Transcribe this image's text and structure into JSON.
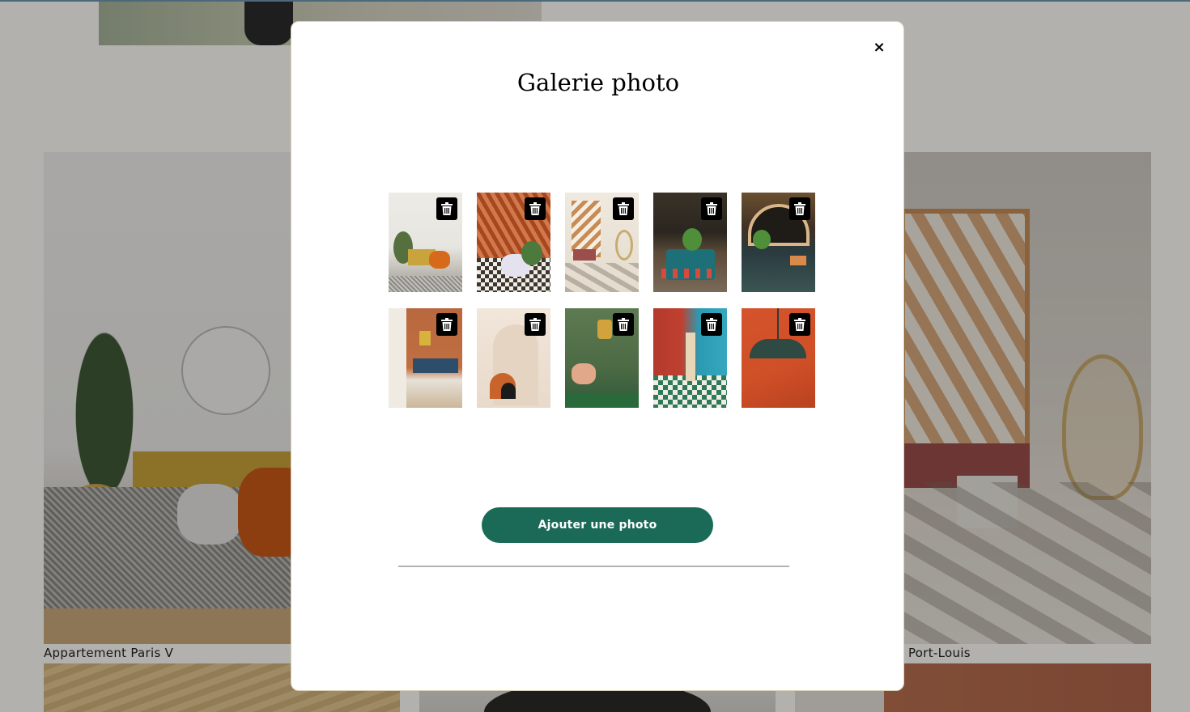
{
  "background": {
    "card_captions": {
      "left": "Appartement Paris V",
      "right": "Port-Louis"
    }
  },
  "modal": {
    "close_label": "×",
    "title": "Galerie photo",
    "photos": [
      {
        "delete_icon": "trash-icon"
      },
      {
        "delete_icon": "trash-icon"
      },
      {
        "delete_icon": "trash-icon"
      },
      {
        "delete_icon": "trash-icon"
      },
      {
        "delete_icon": "trash-icon"
      },
      {
        "delete_icon": "trash-icon"
      },
      {
        "delete_icon": "trash-icon"
      },
      {
        "delete_icon": "trash-icon"
      },
      {
        "delete_icon": "trash-icon"
      },
      {
        "delete_icon": "trash-icon"
      }
    ],
    "add_button_label": "Ajouter une photo",
    "colors": {
      "primary_button": "#1b6a58",
      "delete_button": "#000000",
      "overlay": "rgba(0,0,0,0.30)"
    }
  }
}
